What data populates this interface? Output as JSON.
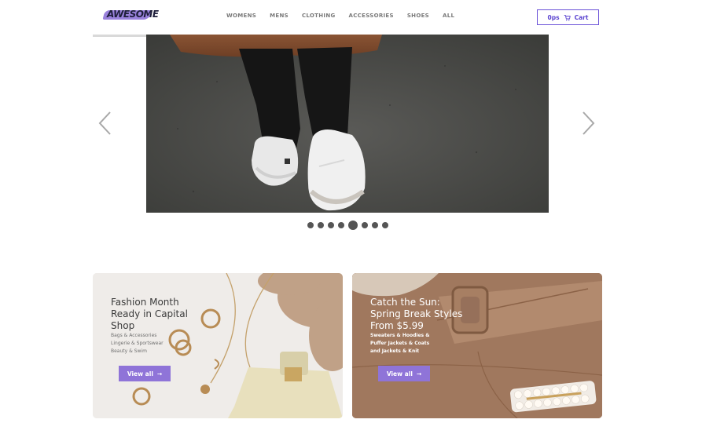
{
  "brand": {
    "logo_text": "AWESOME"
  },
  "nav": {
    "items": [
      {
        "label": "WOMENS"
      },
      {
        "label": "MENS"
      },
      {
        "label": "CLOTHING"
      },
      {
        "label": "ACCESSORIES"
      },
      {
        "label": "SHOES"
      },
      {
        "label": "ALL"
      }
    ]
  },
  "cart": {
    "count_label": "0ps",
    "label": "Cart"
  },
  "slider": {
    "dot_count": 8,
    "active_index": 4
  },
  "cards": [
    {
      "title": "Fashion Month Ready in Capital Shop",
      "subtitle_lines": [
        "Bags & Accessories",
        "Lingerie & Sportswear",
        "Beauty & Swim"
      ],
      "button_label": "View all",
      "button_arrow": "→"
    },
    {
      "title": "Catch the Sun: Spring Break Styles From $5.99",
      "subtitle_lines": [
        "Sweaters & Hoodies &",
        "Puffer Jackets & Coats",
        "and Jackets & Knit"
      ],
      "button_label": "View all",
      "button_arrow": "→"
    }
  ],
  "colors": {
    "accent": "#8f74d8",
    "cart_border": "#6b52d8"
  },
  "icons": {
    "prev": "chevron-left-icon",
    "next": "chevron-right-icon",
    "cart": "cart-icon"
  }
}
